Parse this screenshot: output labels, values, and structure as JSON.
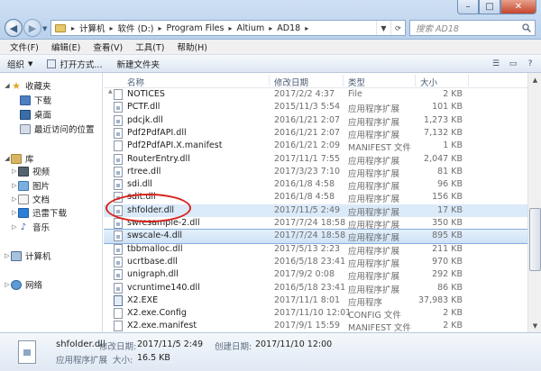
{
  "window": {
    "controls": {
      "minimize": "–",
      "maximize": "□",
      "close": "✕"
    }
  },
  "addressbar": {
    "crumbs": [
      "计算机",
      "软件 (D:)",
      "Program Files",
      "Altium",
      "AD18"
    ]
  },
  "search": {
    "placeholder": "搜索 AD18"
  },
  "menubar": {
    "items": [
      "文件(F)",
      "编辑(E)",
      "查看(V)",
      "工具(T)",
      "帮助(H)"
    ]
  },
  "toolbar": {
    "organize": "组织",
    "open_with": "打开方式...",
    "new_folder": "新建文件夹"
  },
  "navpane": {
    "favorites": "收藏夹",
    "downloads": "下载",
    "desktop": "桌面",
    "recent": "最近访问的位置",
    "libraries": "库",
    "videos": "视频",
    "pictures": "图片",
    "documents": "文档",
    "thunder": "迅雷下载",
    "music": "音乐",
    "computer": "计算机",
    "network": "网络"
  },
  "columns": {
    "name": "名称",
    "date": "修改日期",
    "type": "类型",
    "size": "大小"
  },
  "files": [
    {
      "name": "NOTICES",
      "date": "2017/2/2 4:37",
      "type": "File",
      "size": "2 KB",
      "kind": "file"
    },
    {
      "name": "PCTF.dll",
      "date": "2015/11/3 5:54",
      "type": "应用程序扩展",
      "size": "101 KB",
      "kind": "dll"
    },
    {
      "name": "pdcjk.dll",
      "date": "2016/1/21 2:07",
      "type": "应用程序扩展",
      "size": "1,273 KB",
      "kind": "dll"
    },
    {
      "name": "Pdf2PdfAPI.dll",
      "date": "2016/1/21 2:07",
      "type": "应用程序扩展",
      "size": "7,132 KB",
      "kind": "dll"
    },
    {
      "name": "Pdf2PdfAPI.X.manifest",
      "date": "2016/1/21 2:09",
      "type": "MANIFEST 文件",
      "size": "1 KB",
      "kind": "file"
    },
    {
      "name": "RouterEntry.dll",
      "date": "2017/11/1 7:55",
      "type": "应用程序扩展",
      "size": "2,047 KB",
      "kind": "dll"
    },
    {
      "name": "rtree.dll",
      "date": "2017/3/23 7:10",
      "type": "应用程序扩展",
      "size": "81 KB",
      "kind": "dll"
    },
    {
      "name": "sdi.dll",
      "date": "2016/1/8 4:58",
      "type": "应用程序扩展",
      "size": "96 KB",
      "kind": "dll"
    },
    {
      "name": "sdit.dll",
      "date": "2016/1/8 4:58",
      "type": "应用程序扩展",
      "size": "156 KB",
      "kind": "dll"
    },
    {
      "name": "shfolder.dll",
      "date": "2017/11/5 2:49",
      "type": "应用程序扩展",
      "size": "17 KB",
      "kind": "dll"
    },
    {
      "name": "swresample-2.dll",
      "date": "2017/7/24 18:58",
      "type": "应用程序扩展",
      "size": "350 KB",
      "kind": "dll"
    },
    {
      "name": "swscale-4.dll",
      "date": "2017/7/24 18:58",
      "type": "应用程序扩展",
      "size": "895 KB",
      "kind": "dll"
    },
    {
      "name": "tbbmalloc.dll",
      "date": "2017/5/13 2:23",
      "type": "应用程序扩展",
      "size": "211 KB",
      "kind": "dll"
    },
    {
      "name": "ucrtbase.dll",
      "date": "2016/5/18 23:41",
      "type": "应用程序扩展",
      "size": "970 KB",
      "kind": "dll"
    },
    {
      "name": "unigraph.dll",
      "date": "2017/9/2 0:08",
      "type": "应用程序扩展",
      "size": "292 KB",
      "kind": "dll"
    },
    {
      "name": "vcruntime140.dll",
      "date": "2016/5/18 23:41",
      "type": "应用程序扩展",
      "size": "86 KB",
      "kind": "dll"
    },
    {
      "name": "X2.EXE",
      "date": "2017/11/1 8:01",
      "type": "应用程序",
      "size": "37,983 KB",
      "kind": "exe"
    },
    {
      "name": "X2.exe.Config",
      "date": "2017/11/10 12:01",
      "type": "CONFIG 文件",
      "size": "2 KB",
      "kind": "file"
    },
    {
      "name": "X2.exe.manifest",
      "date": "2017/9/1 15:59",
      "type": "MANIFEST 文件",
      "size": "2 KB",
      "kind": "file"
    }
  ],
  "highlighted_row": 9,
  "selected_row": 11,
  "details": {
    "name": "shfolder.dll",
    "modified_label": "修改日期:",
    "modified": "2017/11/5 2:49",
    "created_label": "创建日期:",
    "created": "2017/11/10 12:00",
    "type": "应用程序扩展",
    "size_label": "大小:",
    "size": "16.5 KB"
  },
  "annotation": {
    "color": "#d8231c"
  }
}
